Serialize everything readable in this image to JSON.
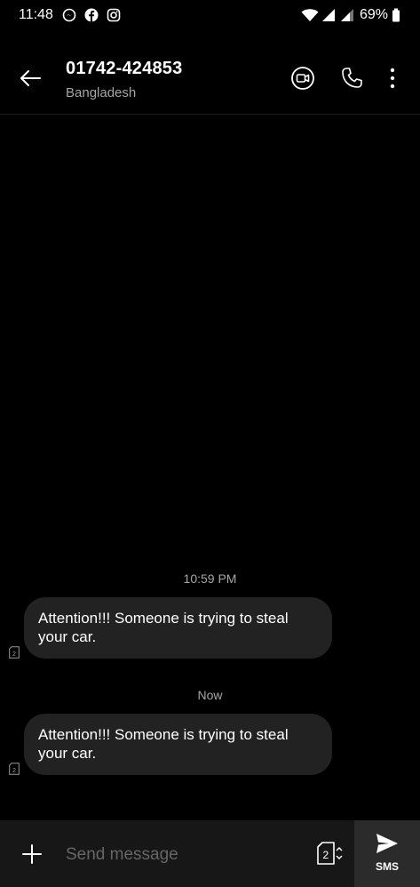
{
  "status_bar": {
    "time": "11:48",
    "battery": "69%",
    "notification_icons": [
      "messenger-icon",
      "facebook-icon",
      "instagram-icon"
    ],
    "system_icons": [
      "wifi-icon",
      "signal-icon",
      "signal-icon",
      "battery-icon"
    ]
  },
  "header": {
    "title": "01742-424853",
    "subtitle": "Bangladesh",
    "actions": [
      "video-call-icon",
      "phone-icon",
      "more-vert-icon"
    ]
  },
  "conversation": {
    "messages": [
      {
        "timestamp": "10:59 PM",
        "text": "Attention!!! Someone is trying to steal your car.",
        "sim": "2"
      },
      {
        "timestamp": "Now",
        "text": "Attention!!! Someone is trying to steal your car.",
        "sim": "2"
      }
    ]
  },
  "compose": {
    "placeholder": "Send message",
    "value": "",
    "sim_label": "2",
    "send_label": "SMS"
  },
  "colors": {
    "background": "#000000",
    "bubble": "#222222",
    "compose_bar": "#171717",
    "send_button": "#2b2b2b",
    "muted_text": "#a6a6a6"
  }
}
